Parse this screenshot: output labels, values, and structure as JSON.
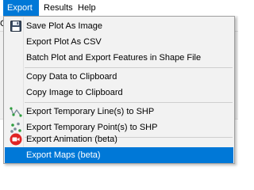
{
  "menubar": {
    "export": "Export",
    "results": "Results",
    "help": "Help"
  },
  "background": {
    "fragment": "C"
  },
  "menu": {
    "items": [
      {
        "label": "Save Plot As Image",
        "icon": "floppy-disk-icon"
      },
      {
        "label": "Export Plot As CSV",
        "icon": ""
      },
      {
        "label": "Batch Plot and Export Features in Shape File",
        "icon": ""
      },
      {
        "label": "Copy Data to Clipboard",
        "icon": ""
      },
      {
        "label": "Copy Image to Clipboard",
        "icon": ""
      },
      {
        "label": "Export Temporary Line(s) to SHP",
        "icon": "line-shape-icon"
      },
      {
        "label": "Export Temporary Point(s) to SHP",
        "icon": "points-shape-icon"
      },
      {
        "label": "Export Animation (beta)",
        "icon": "video-camera-icon"
      },
      {
        "label": "Export Maps (beta)",
        "icon": ""
      }
    ]
  },
  "colors": {
    "highlight": "#0078d7",
    "menu_bg": "#f2f2f2",
    "video_icon": "#e02424"
  }
}
